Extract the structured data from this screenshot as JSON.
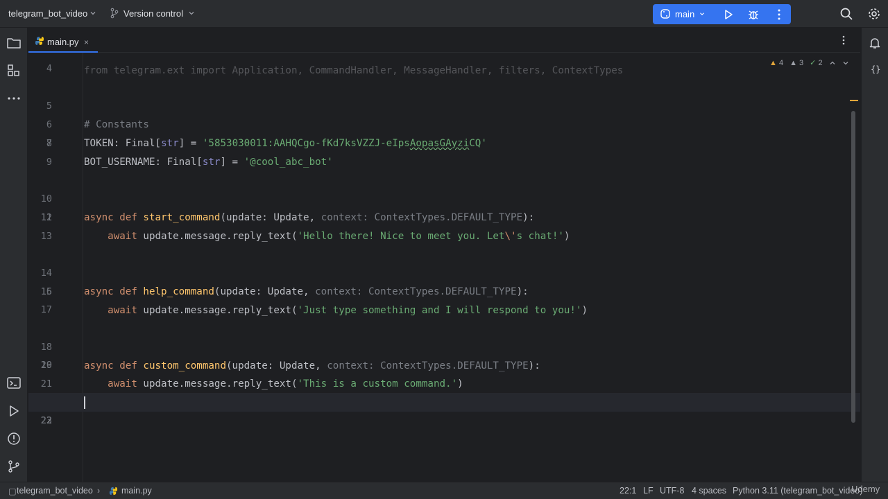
{
  "titlebar": {
    "project": "telegram_bot_video",
    "vcs": "Version control",
    "branch": "main",
    "icons": [
      "chevron-down-icon",
      "branch-icon",
      "python-icon",
      "run-icon",
      "debug-icon",
      "more-vertical-icon",
      "search-icon",
      "settings-icon"
    ]
  },
  "left_tools": [
    "folder-icon",
    "structure-icon",
    "more-horizontal-icon",
    "terminal-icon",
    "run-icon",
    "problems-icon",
    "git-icon"
  ],
  "right_tools": [
    "notifications-icon",
    "json-icon"
  ],
  "tab": {
    "label": "main.py",
    "close": "×"
  },
  "inspections": {
    "warnings": "4",
    "weak_warnings": "3",
    "typos": "2"
  },
  "editor": {
    "partial_top_line": "from telegram.ext import Application, CommandHandler, MessageHandler, filters, ContextTypes",
    "lines": [
      {
        "n": "4"
      },
      {
        "n": "5",
        "comment": "# Constants"
      },
      {
        "n": "6",
        "var": "TOKEN",
        "sep": ": Final[",
        "type": "str",
        "eq": "] = ",
        "value_a": "'5853030011:AAHQCgo-fKd7ksVZZJ-eIps",
        "value_b": "AopasGAyzi",
        "value_c": "CQ'"
      },
      {
        "n": "7",
        "var": "BOT_USERNAME",
        "sep": ": Final[",
        "type": "str",
        "eq": "] = ",
        "value": "'@cool_abc_bot'"
      },
      {
        "n": "8"
      },
      {
        "n": "9"
      },
      {
        "n": "10",
        "kw": "async def ",
        "fn": "start_command",
        "params": "(update: Update, ",
        "hint": "context: ContextTypes.DEFAULT_TYPE",
        "end": "):"
      },
      {
        "n": "11",
        "kw": "    await ",
        "call": "update.message.reply_text(",
        "str_a": "'Hello there! Nice to meet you. Let",
        "esc": "\\'",
        "str_b": "s chat!'",
        "end": ")"
      },
      {
        "n": "12"
      },
      {
        "n": "13"
      },
      {
        "n": "14",
        "kw": "async def ",
        "fn": "help_command",
        "params": "(update: Update, ",
        "hint": "context: ContextTypes.DEFAULT_TYPE",
        "end": "):"
      },
      {
        "n": "15",
        "kw": "    await ",
        "call": "update.message.reply_text(",
        "str": "'Just type something and I will respond to you!'",
        "end": ")"
      },
      {
        "n": "16"
      },
      {
        "n": "17"
      },
      {
        "n": "18",
        "kw": "async def ",
        "fn": "custom_command",
        "params": "(update: Update, ",
        "hint": "context: ContextTypes.DEFAULT_TYPE",
        "end": "):"
      },
      {
        "n": "19",
        "kw": "    await ",
        "call": "update.message.reply_text(",
        "str": "'This is a custom command.'",
        "end": ")"
      },
      {
        "n": "20"
      },
      {
        "n": "21"
      },
      {
        "n": "22"
      },
      {
        "n": "23"
      }
    ]
  },
  "statusbar": {
    "breadcrumb_project": "telegram_bot_video",
    "breadcrumb_file": "main.py",
    "position": "22:1",
    "line_sep": "LF",
    "encoding": "UTF-8",
    "indent": "4 spaces",
    "interpreter": "Python 3.11 (telegram_bot_video)",
    "watermark": "Udemy"
  },
  "colors": {
    "accent": "#3574f0",
    "background": "#1e1f22",
    "panel": "#2b2d30",
    "keyword": "#cf8e6d",
    "string": "#6aab73",
    "function": "#ffc66d"
  }
}
